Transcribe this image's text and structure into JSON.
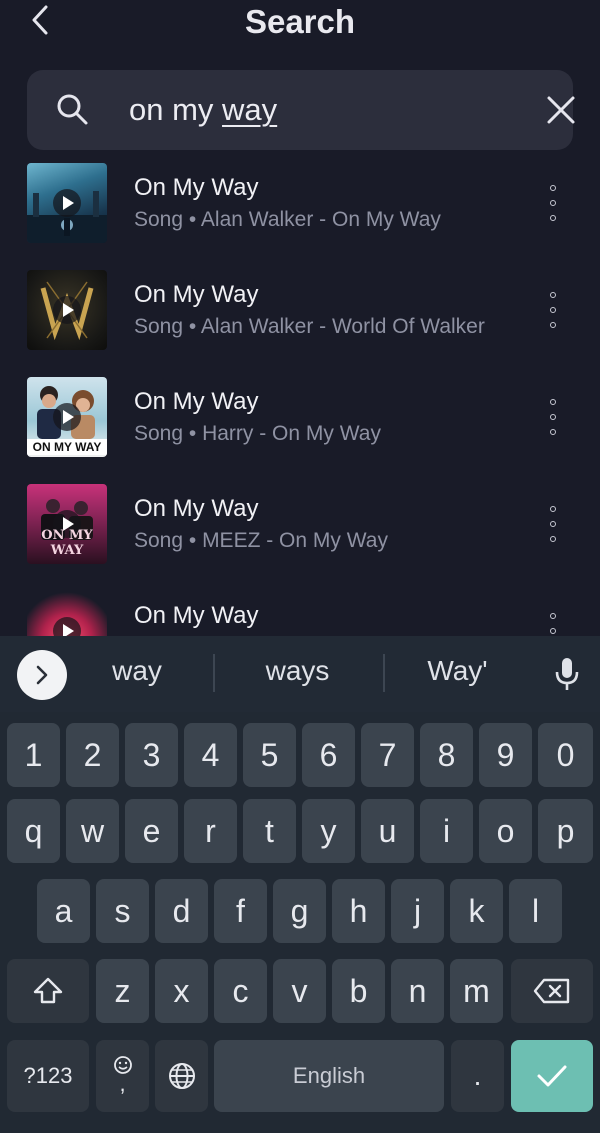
{
  "header": {
    "title": "Search"
  },
  "search": {
    "query_prefix": "on my ",
    "query_underlined": "way"
  },
  "results": [
    {
      "title": "On My Way",
      "subtitle": "Song • Alan Walker - On My Way"
    },
    {
      "title": "On My Way",
      "subtitle": "Song • Alan Walker - World Of Walker"
    },
    {
      "title": "On My Way",
      "subtitle": "Song • Harry - On My Way",
      "thumb_caption": "ON MY WAY"
    },
    {
      "title": "On My Way",
      "subtitle": "Song • MEEZ - On My Way",
      "thumb_caption": "ON MY WAY"
    },
    {
      "title": "On My Way",
      "subtitle": ""
    }
  ],
  "keyboard": {
    "suggestions": [
      "way",
      "ways",
      "Way'"
    ],
    "row_numbers": [
      "1",
      "2",
      "3",
      "4",
      "5",
      "6",
      "7",
      "8",
      "9",
      "0"
    ],
    "row_1": [
      "q",
      "w",
      "e",
      "r",
      "t",
      "y",
      "u",
      "i",
      "o",
      "p"
    ],
    "row_2": [
      "a",
      "s",
      "d",
      "f",
      "g",
      "h",
      "j",
      "k",
      "l"
    ],
    "row_3": [
      "z",
      "x",
      "c",
      "v",
      "b",
      "n",
      "m"
    ],
    "symbols_label": "?123",
    "comma_label": ",",
    "space_label": "English",
    "period_label": ".",
    "icons": {
      "shift": "shift-icon",
      "backspace": "backspace-icon",
      "enter": "check-icon",
      "globe": "globe-icon",
      "emoji": "emoji-icon",
      "mic": "mic-icon"
    },
    "accent_color": "#6dbfb2"
  }
}
